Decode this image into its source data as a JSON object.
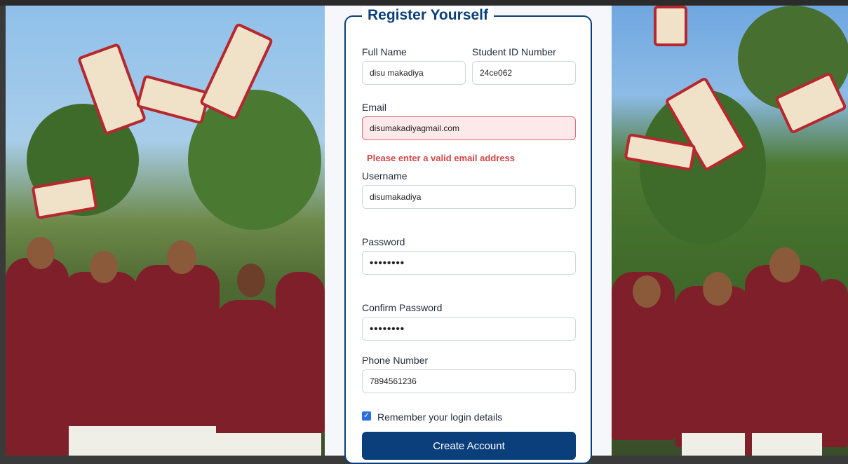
{
  "form": {
    "title": "Register Yourself",
    "full_name_label": "Full Name",
    "full_name_value": "disu makadiya",
    "student_id_label": "Student ID Number",
    "student_id_value": "24ce062",
    "email_label": "Email",
    "email_value": "disumakadiyagmail.com",
    "email_error": "Please enter a valid email address",
    "username_label": "Username",
    "username_value": "disumakadiya",
    "password_label": "Password",
    "password_value": "••••••••",
    "confirm_password_label": "Confirm Password",
    "confirm_password_value": "••••••••",
    "phone_label": "Phone Number",
    "phone_value": "7894561236",
    "remember_label": "Remember your login details",
    "remember_checked": true,
    "submit_label": "Create Account"
  },
  "colors": {
    "accent": "#0b3f7c",
    "error": "#d64545",
    "error_bg": "#fde8ea",
    "checkbox": "#2d6cdf"
  }
}
